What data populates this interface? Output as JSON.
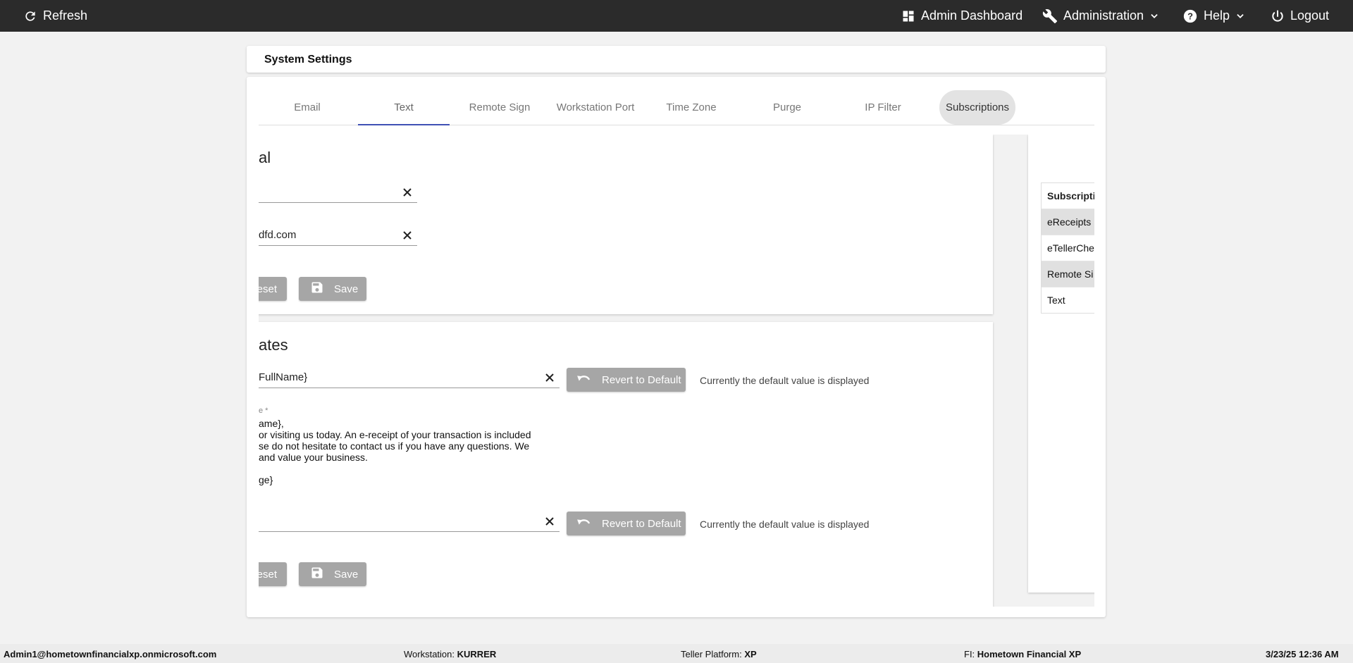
{
  "topbar": {
    "refresh": "Refresh",
    "admin_dashboard": "Admin Dashboard",
    "administration": "Administration",
    "help": "Help",
    "logout": "Logout"
  },
  "page": {
    "title": "System Settings"
  },
  "tabs": [
    "Email",
    "Text",
    "Remote Sign",
    "Workstation Port",
    "Time Zone",
    "Purge",
    "IP Filter",
    "Subscriptions"
  ],
  "active_tab": "Text",
  "general_panel": {
    "heading_fragment": "al",
    "field1_value": "",
    "field2_value": "dfd.com",
    "reset_label": "eset",
    "save_label": "Save"
  },
  "templates_panel": {
    "heading_fragment": "ates",
    "subject_value": "FullName}",
    "revert_label": "Revert to Default",
    "default_note": "Currently the default value is displayed",
    "message_label_fragment": "e *",
    "message_lines": [
      "ame},",
      "or visiting us today. An e-receipt of your transaction is included",
      "se do not hesitate to contact us if you have any questions. We",
      "and value your business.",
      "",
      "ge}"
    ],
    "field3_value": "",
    "revert2_label": "Revert to Default",
    "default_note2": "Currently the default value is displayed",
    "reset_label": "eset",
    "save_label": "Save"
  },
  "subscriptions_panel": {
    "header": "Subscripti",
    "rows": [
      "eReceipts",
      "eTellerChe",
      "Remote Si",
      "Text"
    ]
  },
  "statusbar": {
    "user": "Admin1@hometownfinancialxp.onmicrosoft.com",
    "workstation_label": "Workstation:",
    "workstation_value": "KURRER",
    "platform_label": "Teller Platform:",
    "platform_value": "XP",
    "fi_label": "FI:",
    "fi_value": "Hometown Financial XP",
    "datetime": "3/23/25 12:36 AM"
  },
  "colors": {
    "topbar_bg": "#2b2b2b",
    "tab_indicator": "#3f51b5",
    "button_bg": "#a6a6a6"
  },
  "icons": [
    "refresh-icon",
    "dashboard-icon",
    "wrench-icon",
    "help-icon",
    "power-icon",
    "chevron-down-icon",
    "close-icon",
    "save-icon",
    "undo-icon"
  ]
}
